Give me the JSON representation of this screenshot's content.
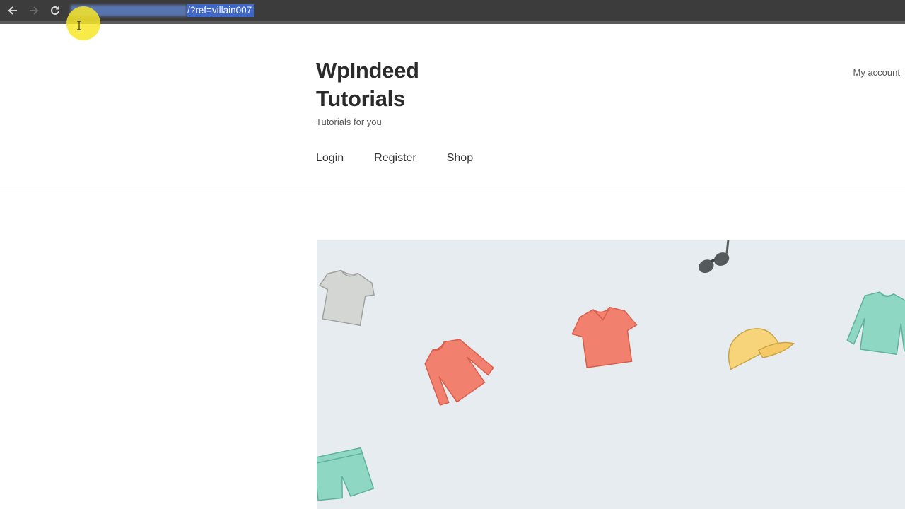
{
  "browser": {
    "address_visible_text": "/?ref=villain007"
  },
  "site": {
    "title_line1": "WpIndeed",
    "title_line2": "Tutorials",
    "tagline": "Tutorials for you",
    "my_account": "My account"
  },
  "menu": {
    "items": [
      {
        "label": "Login"
      },
      {
        "label": "Register"
      },
      {
        "label": "Shop"
      }
    ]
  },
  "hero": {
    "background": "#e6ecef",
    "items": [
      "gray-tshirt-icon",
      "sunglasses-icon",
      "salmon-tshirt-icon",
      "salmon-sweater-icon",
      "yellow-cap-icon",
      "mint-longsleeve-icon",
      "mint-shorts-icon"
    ]
  },
  "colors": {
    "salmon": "#f2806e",
    "mint": "#8ed8c3",
    "yellow": "#f7d47a",
    "gray": "#cfd3d0"
  }
}
